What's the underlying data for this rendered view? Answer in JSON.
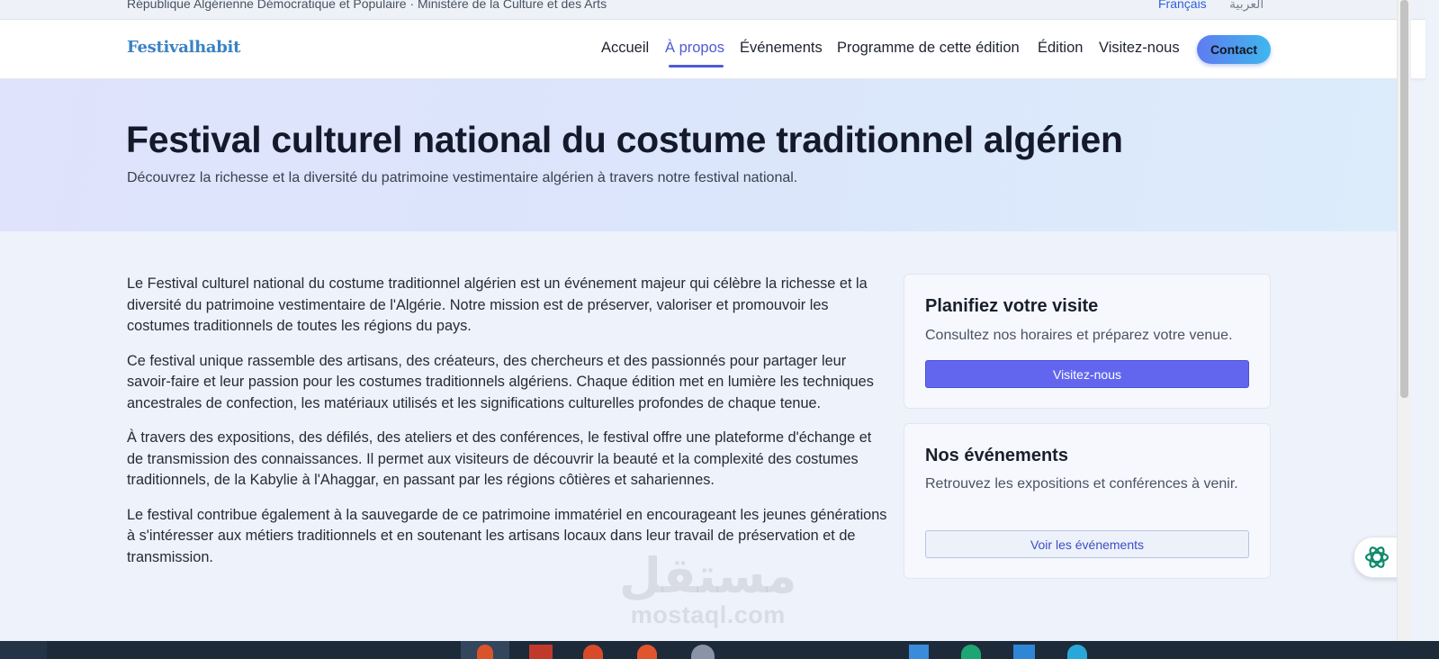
{
  "topbar": {
    "government_text": "République Algérienne Démocratique et Populaire · Ministère de la Culture et des Arts",
    "lang_fr": "Français",
    "lang_ar": "العربية"
  },
  "navbar": {
    "brand": "Festivalhabit",
    "links": [
      "Accueil",
      "À propos",
      "Événements",
      "Programme de cette édition",
      "Édition",
      "Visitez-nous"
    ],
    "active_link": "À propos",
    "contact_label": "Contact"
  },
  "hero": {
    "title": "Festival culturel national du costume traditionnel algérien",
    "subtitle": "Découvrez la richesse et la diversité du patrimoine vestimentaire algérien à travers notre festival national."
  },
  "content": {
    "paragraphs": [
      "Le Festival culturel national du costume traditionnel algérien est un événement majeur qui célèbre la richesse et la diversité du patrimoine vestimentaire de l'Algérie. Notre mission est de préserver, valoriser et promouvoir les costumes traditionnels de toutes les régions du pays.",
      "Ce festival unique rassemble des artisans, des créateurs, des chercheurs et des passionnés pour partager leur savoir-faire et leur passion pour les costumes traditionnels algériens. Chaque édition met en lumière les techniques ancestrales de confection, les matériaux utilisés et les significations culturelles profondes de chaque tenue.",
      "À travers des expositions, des défilés, des ateliers et des conférences, le festival offre une plateforme d'échange et de transmission des connaissances. Il permet aux visiteurs de découvrir la beauté et la complexité des costumes traditionnels, de la Kabylie à l'Ahaggar, en passant par les régions côtières et sahariennes.",
      "Le festival contribue également à la sauvegarde de ce patrimoine immatériel en encourageant les jeunes générations à s'intéresser aux métiers traditionnels et en soutenant les artisans locaux dans leur travail de préservation et de transmission."
    ]
  },
  "sidebar": {
    "visit_card": {
      "title": "Planifiez votre visite",
      "description": "Consultez nos horaires et préparez votre venue.",
      "button_label": "Visitez-nous"
    },
    "events_card": {
      "title": "Nos événements",
      "description": "Retrouvez les expositions et conférences à venir.",
      "button_label": "Voir les événements"
    }
  },
  "watermark": {
    "arabic": "مستقل",
    "latin": "mostaql.com"
  },
  "colors": {
    "accent": "#4f5bd5",
    "primary_button": "#6266ef",
    "brand": "#3b82c4",
    "hero_bg": "#dfe3fb",
    "page_bg": "#eef2fb"
  },
  "icons": {
    "assistant": "ai-assistant-icon"
  }
}
